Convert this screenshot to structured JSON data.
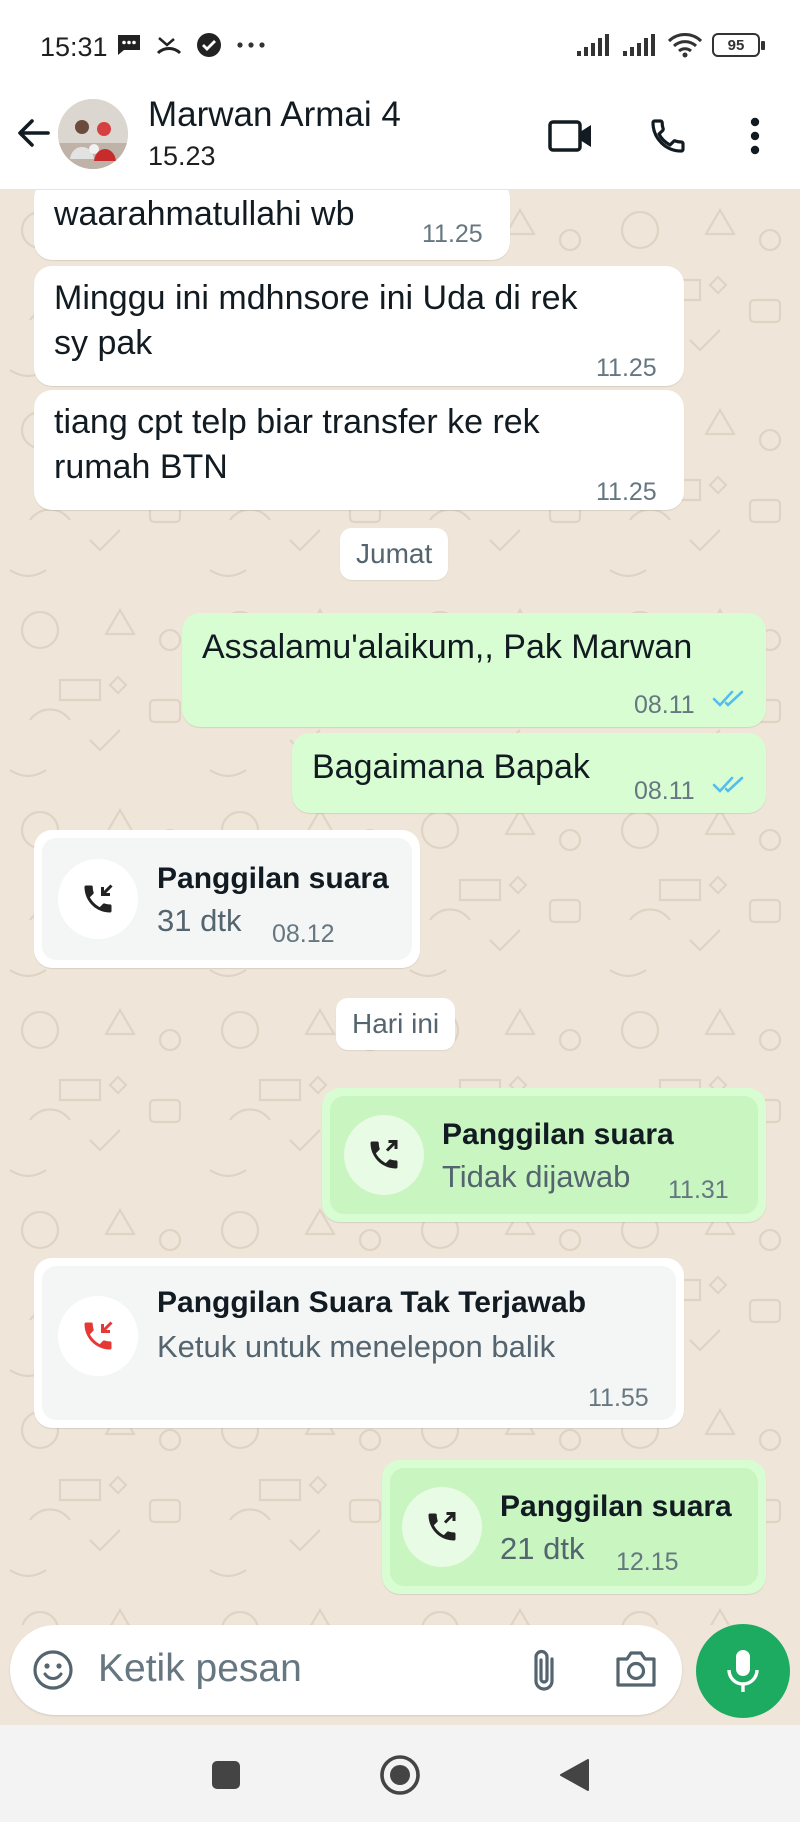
{
  "status_bar": {
    "time": "15:31",
    "battery": "95",
    "left_icons": [
      "message-icon",
      "missed-call-icon",
      "check-circle-icon",
      "more-dots-icon"
    ],
    "right_icons": [
      "signal-icon",
      "signal-icon",
      "wifi-icon",
      "battery-icon"
    ]
  },
  "header": {
    "contact_name": "Marwan Armai 4",
    "last_seen": "15.23",
    "icons": [
      "back-arrow-icon",
      "video-call-icon",
      "phone-icon",
      "more-vertical-icon"
    ]
  },
  "messages": [
    {
      "type": "text",
      "direction": "incoming",
      "text": "waarahmatullahi wb",
      "time": "11.25"
    },
    {
      "type": "text",
      "direction": "incoming",
      "line1": "Minggu ini mdhnsore ini Uda di rek",
      "line2": "sy pak",
      "time": "11.25"
    },
    {
      "type": "text",
      "direction": "incoming",
      "line1": "tiang cpt telp biar transfer ke rek",
      "line2": "rumah BTN",
      "time": "11.25"
    },
    {
      "type": "date",
      "text": "Jumat"
    },
    {
      "type": "text",
      "direction": "outgoing",
      "text": "Assalamu'alaikum,, Pak Marwan",
      "time": "08.11",
      "status": "read"
    },
    {
      "type": "text",
      "direction": "outgoing",
      "text": "Bagaimana Bapak",
      "time": "08.11",
      "status": "read"
    },
    {
      "type": "call",
      "direction": "incoming",
      "title": "Panggilan suara",
      "subtitle": "31 dtk",
      "time": "08.12"
    },
    {
      "type": "date",
      "text": "Hari ini"
    },
    {
      "type": "call",
      "direction": "outgoing",
      "title": "Panggilan suara",
      "subtitle": "Tidak dijawab",
      "time": "11.31"
    },
    {
      "type": "call",
      "direction": "missed",
      "title": "Panggilan Suara Tak Terjawab",
      "subtitle": "Ketuk untuk menelepon balik",
      "time": "11.55"
    },
    {
      "type": "call",
      "direction": "outgoing",
      "title": "Panggilan suara",
      "subtitle": "21 dtk",
      "time": "12.15"
    }
  ],
  "composer": {
    "placeholder": "Ketik pesan",
    "icons": [
      "emoji-icon",
      "attach-icon",
      "camera-icon",
      "mic-icon"
    ]
  },
  "colors": {
    "chat_bg": "#efe6d9",
    "outgoing_bubble": "#d9fdd3",
    "incoming_bubble": "#ffffff",
    "accent_green": "#1daa61",
    "read_tick": "#53bdeb",
    "missed_red": "#e53935"
  }
}
